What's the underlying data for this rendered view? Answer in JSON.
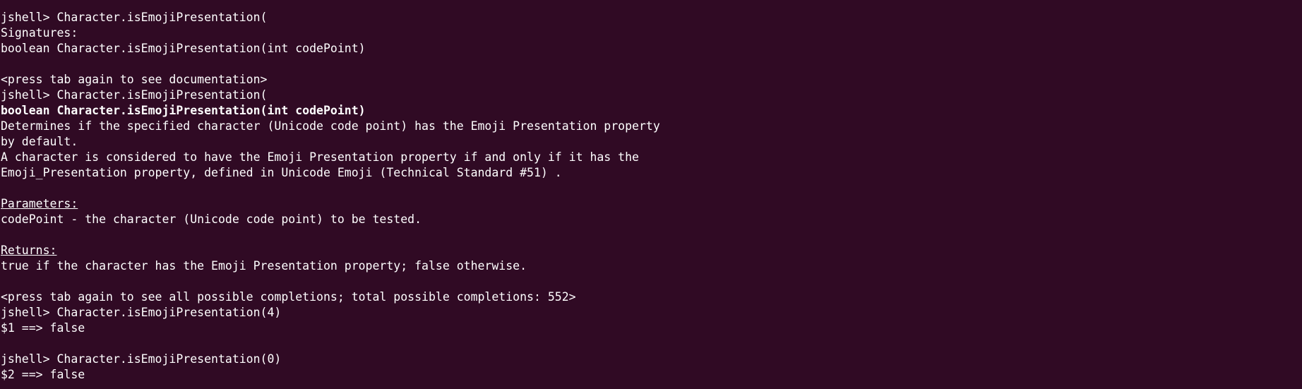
{
  "terminal": {
    "background": "#300a24",
    "foreground": "#ffffff",
    "lines": [
      {
        "text": "      ",
        "style": "normal"
      },
      {
        "text": "jshell> Character.isEmojiPresentation(",
        "style": "normal"
      },
      {
        "text": "Signatures:",
        "style": "normal"
      },
      {
        "text": "boolean Character.isEmojiPresentation(int codePoint)",
        "style": "normal"
      },
      {
        "text": "",
        "style": "normal"
      },
      {
        "text": "<press tab again to see documentation>",
        "style": "normal"
      },
      {
        "text": "jshell> Character.isEmojiPresentation(",
        "style": "normal"
      },
      {
        "text": "boolean Character.isEmojiPresentation(int codePoint)",
        "style": "bold"
      },
      {
        "text": "Determines if the specified character (Unicode code point) has the Emoji Presentation property",
        "style": "normal"
      },
      {
        "text": "by default.",
        "style": "normal"
      },
      {
        "text": "A character is considered to have the Emoji Presentation property if and only if it has the",
        "style": "normal"
      },
      {
        "text": "Emoji_Presentation property, defined in Unicode Emoji (Technical Standard #51) .",
        "style": "normal"
      },
      {
        "text": "",
        "style": "normal"
      },
      {
        "text": "Parameters:",
        "style": "underline"
      },
      {
        "text": "codePoint - the character (Unicode code point) to be tested.",
        "style": "normal"
      },
      {
        "text": "",
        "style": "normal"
      },
      {
        "text": "Returns:",
        "style": "underline"
      },
      {
        "text": "true if the character has the Emoji Presentation property; false otherwise.",
        "style": "normal"
      },
      {
        "text": "",
        "style": "normal"
      },
      {
        "text": "<press tab again to see all possible completions; total possible completions: 552>",
        "style": "normal"
      },
      {
        "text": "jshell> Character.isEmojiPresentation(4)",
        "style": "normal"
      },
      {
        "text": "$1 ==> false",
        "style": "normal"
      },
      {
        "text": "",
        "style": "normal"
      },
      {
        "text": "jshell> Character.isEmojiPresentation(0)",
        "style": "normal"
      },
      {
        "text": "$2 ==> false",
        "style": "normal"
      }
    ]
  }
}
